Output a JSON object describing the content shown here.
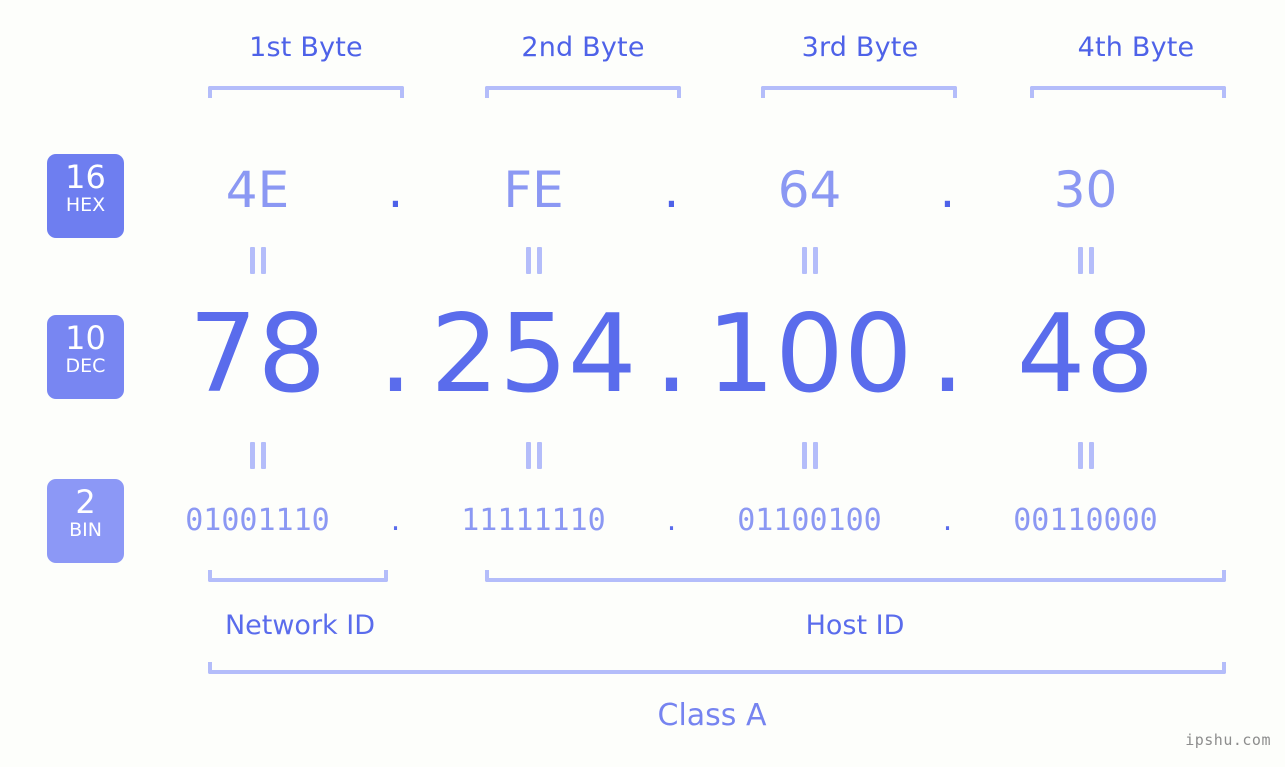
{
  "background_color": "#fdfefb",
  "colors": {
    "accent_strong": "#4e62e8",
    "accent_mid": "#5a6cec",
    "accent_light": "#8b98f3",
    "bracket": "#b4bdfa",
    "badge_hex": "#6e7ef0",
    "badge_dec": "#7886f2",
    "badge_bin": "#8c98f6",
    "watermark": "#8d8d8d"
  },
  "byte_headers": [
    {
      "label": "1st Byte"
    },
    {
      "label": "2nd Byte"
    },
    {
      "label": "3rd Byte"
    },
    {
      "label": "4th Byte"
    }
  ],
  "bases": [
    {
      "number": "16",
      "name": "HEX"
    },
    {
      "number": "10",
      "name": "DEC"
    },
    {
      "number": "2",
      "name": "BIN"
    }
  ],
  "separator": ".",
  "equals_mark": "=",
  "rows": {
    "hex": {
      "base_number": "16",
      "base_name": "HEX",
      "values": [
        "4E",
        "FE",
        "64",
        "30"
      ]
    },
    "dec": {
      "base_number": "10",
      "base_name": "DEC",
      "values": [
        "78",
        "254",
        "100",
        "48"
      ]
    },
    "bin": {
      "base_number": "2",
      "base_name": "BIN",
      "values": [
        "01001110",
        "11111110",
        "01100100",
        "00110000"
      ]
    }
  },
  "ip_address": {
    "hex": "4E.FE.64.30",
    "dec": "78.254.100.48",
    "bin": "01001110.11111110.01100100.00110000"
  },
  "segments": {
    "network_id": "Network ID",
    "host_id": "Host ID"
  },
  "class": "Class A",
  "watermark": "ipshu.com"
}
